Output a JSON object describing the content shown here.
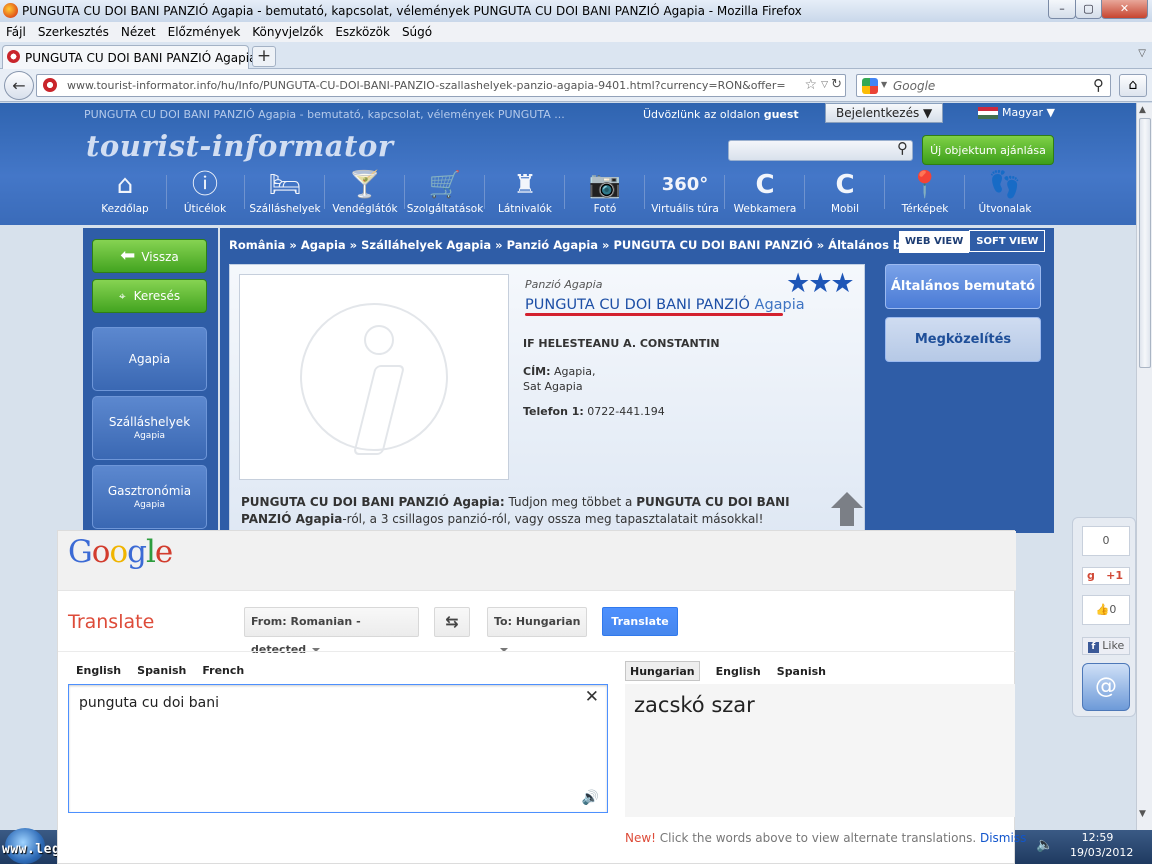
{
  "window": {
    "title": "PUNGUTA CU DOI BANI PANZIÓ Agapia - bemutató, kapcsolat, vélemények PUNGUTA CU DOI BANI PANZIÓ Agapia - Mozilla Firefox",
    "min": "–",
    "max": "▢",
    "close": "✕"
  },
  "menu": [
    "Fájl",
    "Szerkesztés",
    "Nézet",
    "Előzmények",
    "Könyvjelzők",
    "Eszközök",
    "Súgó"
  ],
  "tab": {
    "label": "PUNGUTA CU DOI BANI PANZIÓ Agapia...",
    "new": "+"
  },
  "nav": {
    "url": "www.tourist-informator.info/hu/Info/PUNGUTA-CU-DOI-BANI-PANZIO-szallashelyek-panzio-agapia-9401.html?currency=RON&offer=",
    "search_placeholder": "Google"
  },
  "site": {
    "page_heading": "PUNGUTA CU DOI BANI PANZIÓ Agapia - bemutató, kapcsolat, vélemények PUNGUTA ...",
    "welcome_prefix": "Üdvözlünk az oldalon",
    "welcome_user": "guest",
    "login": "Bejelentkezés ▼",
    "language": "Magyar ▼",
    "logo": "tourist-informator",
    "new_object": "Új objektum ajánlása",
    "nav_items": [
      {
        "label": "Kezdőlap",
        "icon": "⌂"
      },
      {
        "label": "Úticélok",
        "icon": "ⓘ"
      },
      {
        "label": "Szálláshelyek",
        "icon": "🛏"
      },
      {
        "label": "Vendéglátók",
        "icon": "🍸"
      },
      {
        "label": "Szolgáltatások",
        "icon": "🛒"
      },
      {
        "label": "Látnivalók",
        "icon": "♜"
      },
      {
        "label": "Fotó",
        "icon": "📷"
      },
      {
        "label": "Virtuális túra",
        "icon": "360°"
      },
      {
        "label": "Webkamera",
        "icon": "C"
      },
      {
        "label": "Mobil",
        "icon": "C"
      },
      {
        "label": "Térképek",
        "icon": "📍"
      },
      {
        "label": "Útvonalak",
        "icon": "👣"
      }
    ]
  },
  "sidebar": {
    "back": "Vissza",
    "search": "Keresés",
    "items": [
      {
        "label": "Agapia",
        "sub": ""
      },
      {
        "label": "Szálláshelyek",
        "sub": "Agapia"
      },
      {
        "label": "Gasztronómia",
        "sub": "Agapia"
      }
    ]
  },
  "main": {
    "breadcrumb": "România » Agapia » Szálláhelyek Agapia » Panzió Agapia » PUNGUTA CU DOI BANI PANZIÓ » Általános bemutató",
    "web_view": "WEB VIEW",
    "soft_view": "SOFT VIEW",
    "type": "Panzió Agapia",
    "name": "PUNGUTA CU DOI BANI PANZIÓ",
    "city": "Agapia",
    "stars": "★★★",
    "owner": "IF HELESTEANU A. CONSTANTIN",
    "address_label": "CÍM:",
    "address_line1": "Agapia,",
    "address_line2": "Sat Agapia",
    "phone_label": "Telefon 1:",
    "phone": "0722-441.194",
    "desc_bold1": "PUNGUTA CU DOI BANI PANZIÓ Agapia:",
    "desc_text1": " Tudjon meg többet a ",
    "desc_bold2": "PUNGUTA CU DOI BANI PANZIÓ Agapia",
    "desc_text2": "-ról, a 3 csillagos panzió-ról, vagy ossza meg tapasztalatait másokkal!",
    "right_buttons": [
      "Általános bemutató",
      "Megközelítés"
    ]
  },
  "social": {
    "count": "0",
    "gplus": "+1",
    "like_count": "0",
    "like": "Like"
  },
  "translate": {
    "logo_letters": [
      {
        "ch": "G",
        "color": "#3b6ad5"
      },
      {
        "ch": "o",
        "color": "#d23c2d"
      },
      {
        "ch": "o",
        "color": "#f0b400"
      },
      {
        "ch": "g",
        "color": "#3b6ad5"
      },
      {
        "ch": "l",
        "color": "#2e9d3f"
      },
      {
        "ch": "e",
        "color": "#d23c2d"
      }
    ],
    "title": "Translate",
    "from": "From: Romanian - detected",
    "swap": "⇆",
    "to": "To: Hungarian",
    "button": "Translate",
    "src_tabs": [
      "English",
      "Spanish",
      "French"
    ],
    "dst_tabs": [
      "Hungarian",
      "English",
      "Spanish"
    ],
    "source_text": "punguta cu doi bani",
    "clear": "✕",
    "speaker": "🔊",
    "result": "zacskó szar",
    "new_label": "New!",
    "new_text": " Click the words above to view alternate translations. ",
    "dismiss": "Dismiss"
  },
  "taskbar": {
    "time": "12:59",
    "date": "19/03/2012",
    "watermark": "www.legalja.hu"
  }
}
